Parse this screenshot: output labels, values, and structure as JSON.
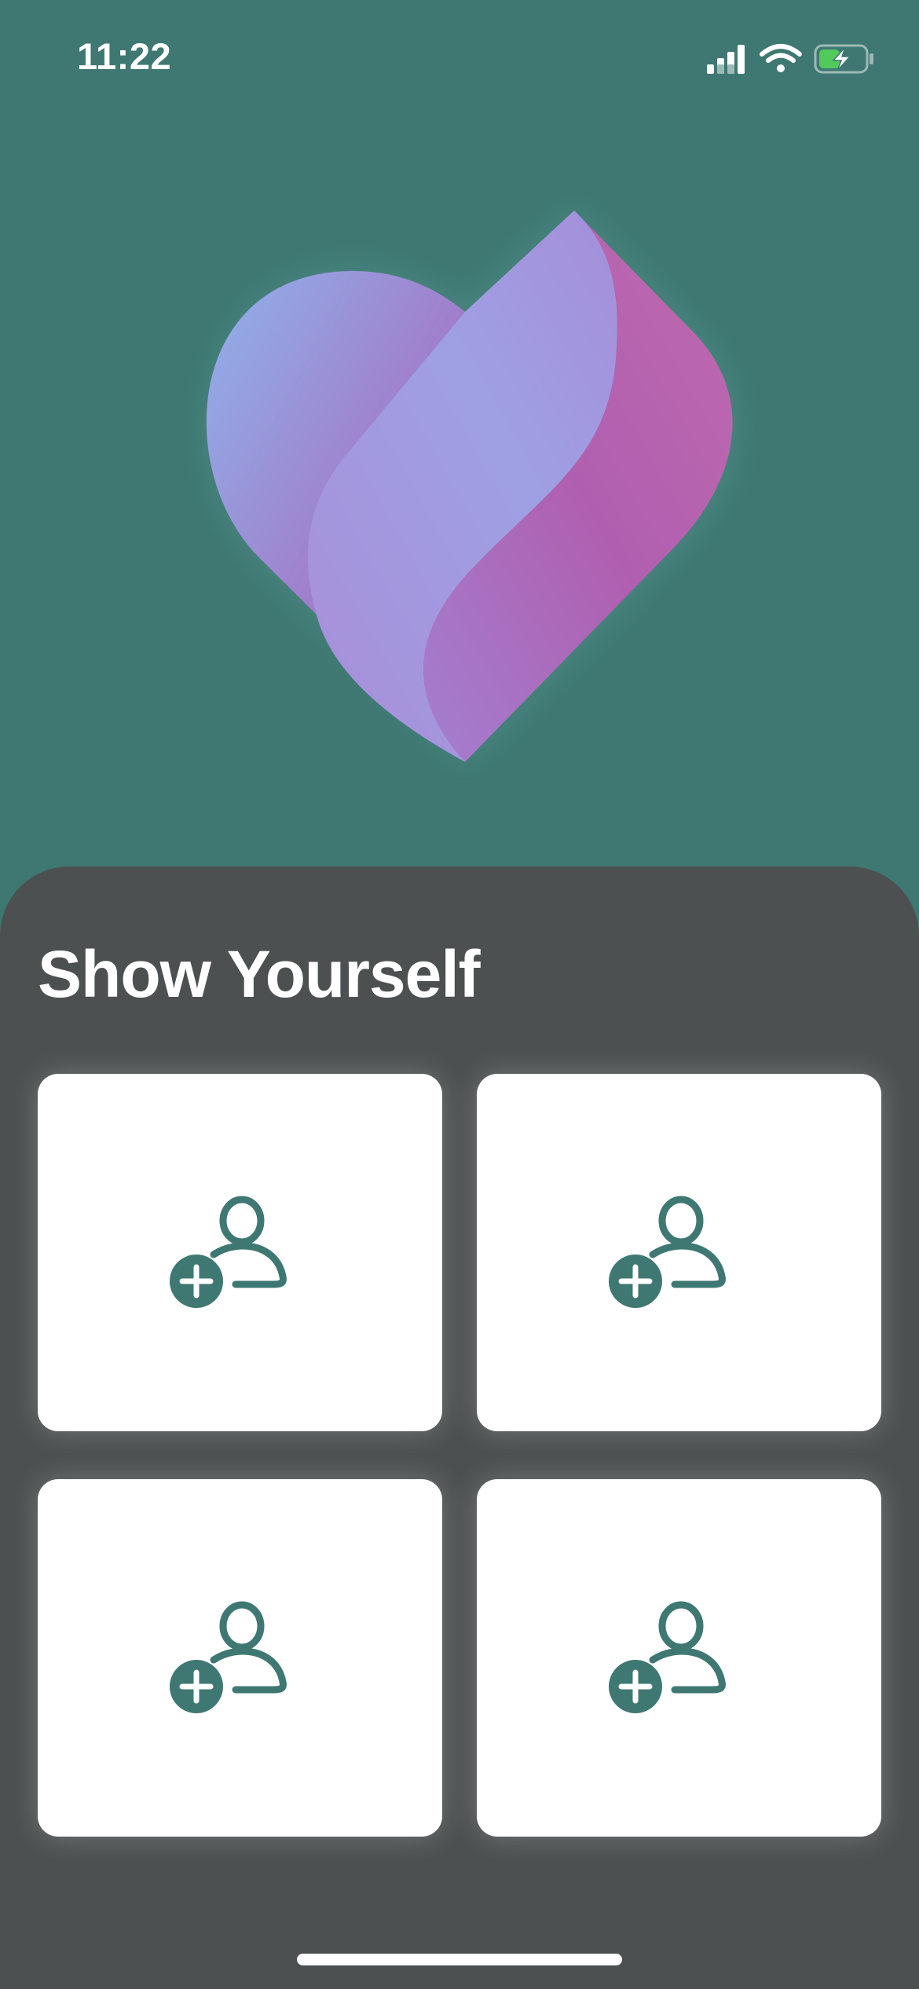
{
  "status_bar": {
    "time": "11:22",
    "icons": [
      "cellular-signal-icon",
      "wifi-icon",
      "battery-charging-icon"
    ]
  },
  "hero": {
    "logo": "heart-logo",
    "colors": {
      "background": "#3f7872",
      "heart_blue": "#8fb2ea",
      "heart_lavender": "#a09be0",
      "heart_magenta": "#b456aa"
    }
  },
  "sheet": {
    "title": "Show Yourself",
    "background": "#4c5051",
    "slots": [
      {
        "icon": "add-person-icon",
        "accent": "#3f7872"
      },
      {
        "icon": "add-person-icon",
        "accent": "#3f7872"
      },
      {
        "icon": "add-person-icon",
        "accent": "#3f7872"
      },
      {
        "icon": "add-person-icon",
        "accent": "#3f7872"
      }
    ]
  }
}
